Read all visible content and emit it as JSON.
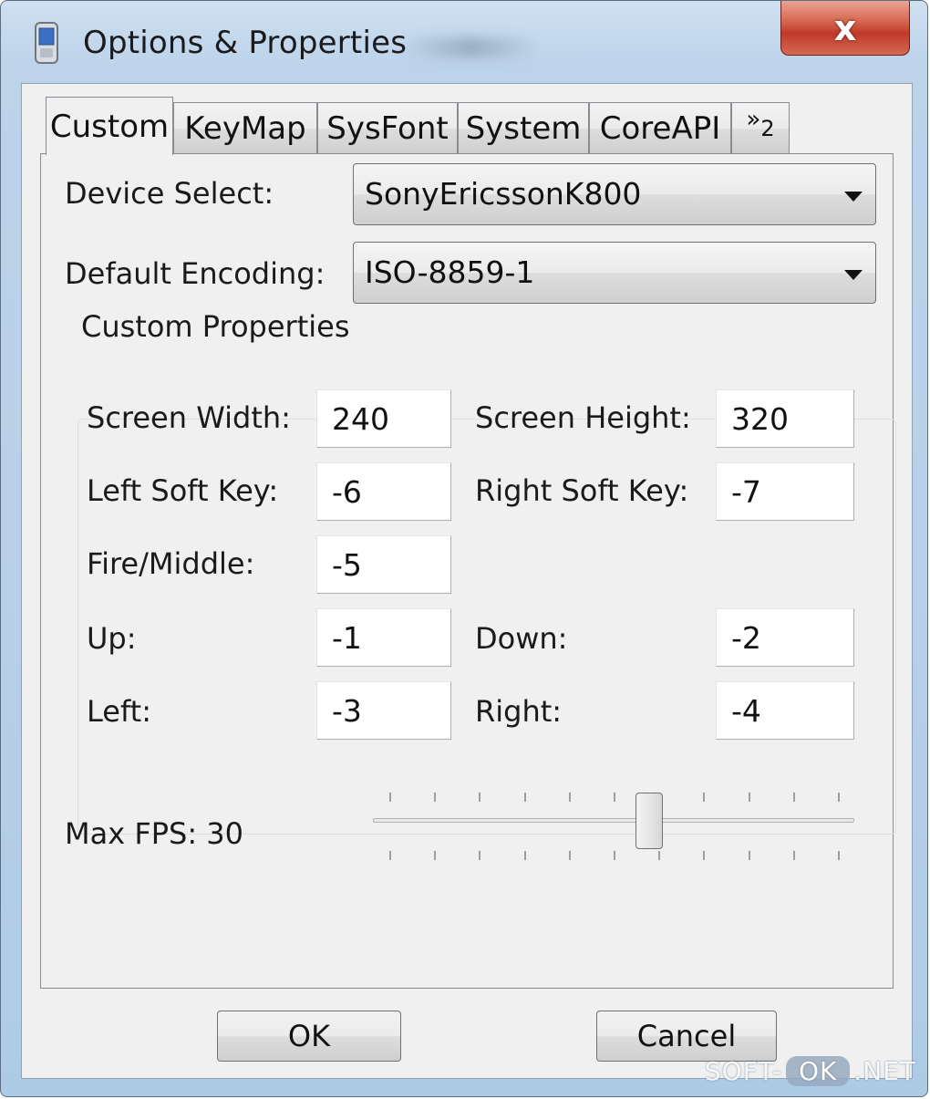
{
  "window": {
    "title": "Options & Properties",
    "close_label": "x"
  },
  "tabs": [
    {
      "label": "Custom",
      "active": true
    },
    {
      "label": "KeyMap",
      "active": false
    },
    {
      "label": "SysFont",
      "active": false
    },
    {
      "label": "System",
      "active": false
    },
    {
      "label": "CoreAPI",
      "active": false
    }
  ],
  "tab_overflow": {
    "chevron": "»",
    "count": "2"
  },
  "device_select": {
    "label": "Device Select:",
    "value": "SonyEricssonK800"
  },
  "default_encoding": {
    "label": "Default Encoding:",
    "value": "ISO-8859-1"
  },
  "custom_properties": {
    "title": "Custom Properties",
    "screen_width": {
      "label": "Screen Width:",
      "value": "240"
    },
    "screen_height": {
      "label": "Screen Height:",
      "value": "320"
    },
    "left_soft_key": {
      "label": "Left Soft Key:",
      "value": "-6"
    },
    "right_soft_key": {
      "label": "Right Soft Key:",
      "value": "-7"
    },
    "fire_middle": {
      "label": "Fire/Middle:",
      "value": "-5"
    },
    "up": {
      "label": "Up:",
      "value": "-1"
    },
    "down": {
      "label": "Down:",
      "value": "-2"
    },
    "left": {
      "label": "Left:",
      "value": "-3"
    },
    "right": {
      "label": "Right:",
      "value": "-4"
    }
  },
  "max_fps": {
    "label": "Max FPS: 30",
    "slider_fraction": 0.58
  },
  "buttons": {
    "ok": "OK",
    "cancel": "Cancel"
  },
  "watermark": {
    "part1": "SOFT-",
    "part2": "OK",
    "part3": ".NET"
  }
}
